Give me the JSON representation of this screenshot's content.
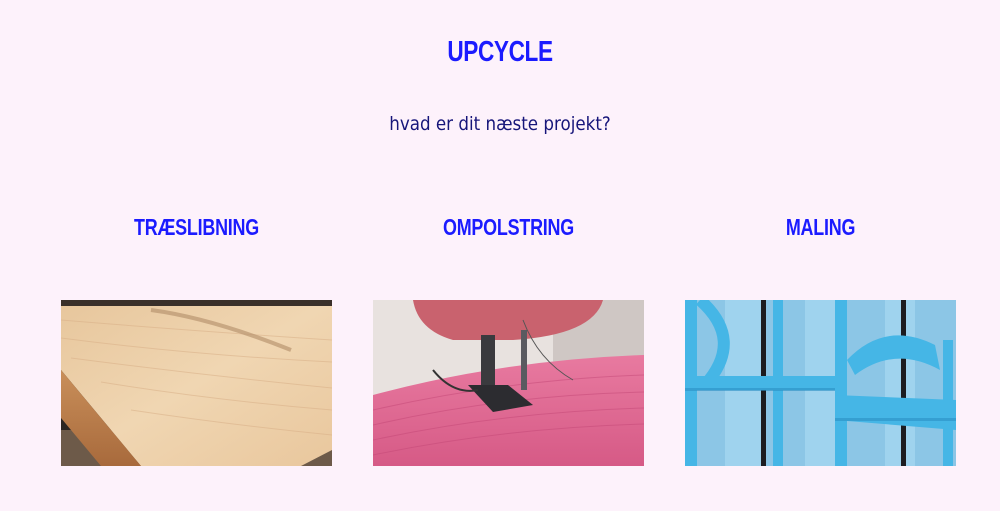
{
  "header": {
    "title": "UPCYCLE",
    "subtitle": "hvad er dit næste projekt?"
  },
  "cards": [
    {
      "title": "TRÆSLIBNING",
      "image": "sanded-wood-plank"
    },
    {
      "title": "OMPOLSTRING",
      "image": "sewing-machine-pink-fabric"
    },
    {
      "title": "MALING",
      "image": "blue-painted-chair"
    }
  ],
  "colors": {
    "background": "#fdf2fb",
    "title": "#1b1bff",
    "subtitle": "#16157a"
  }
}
